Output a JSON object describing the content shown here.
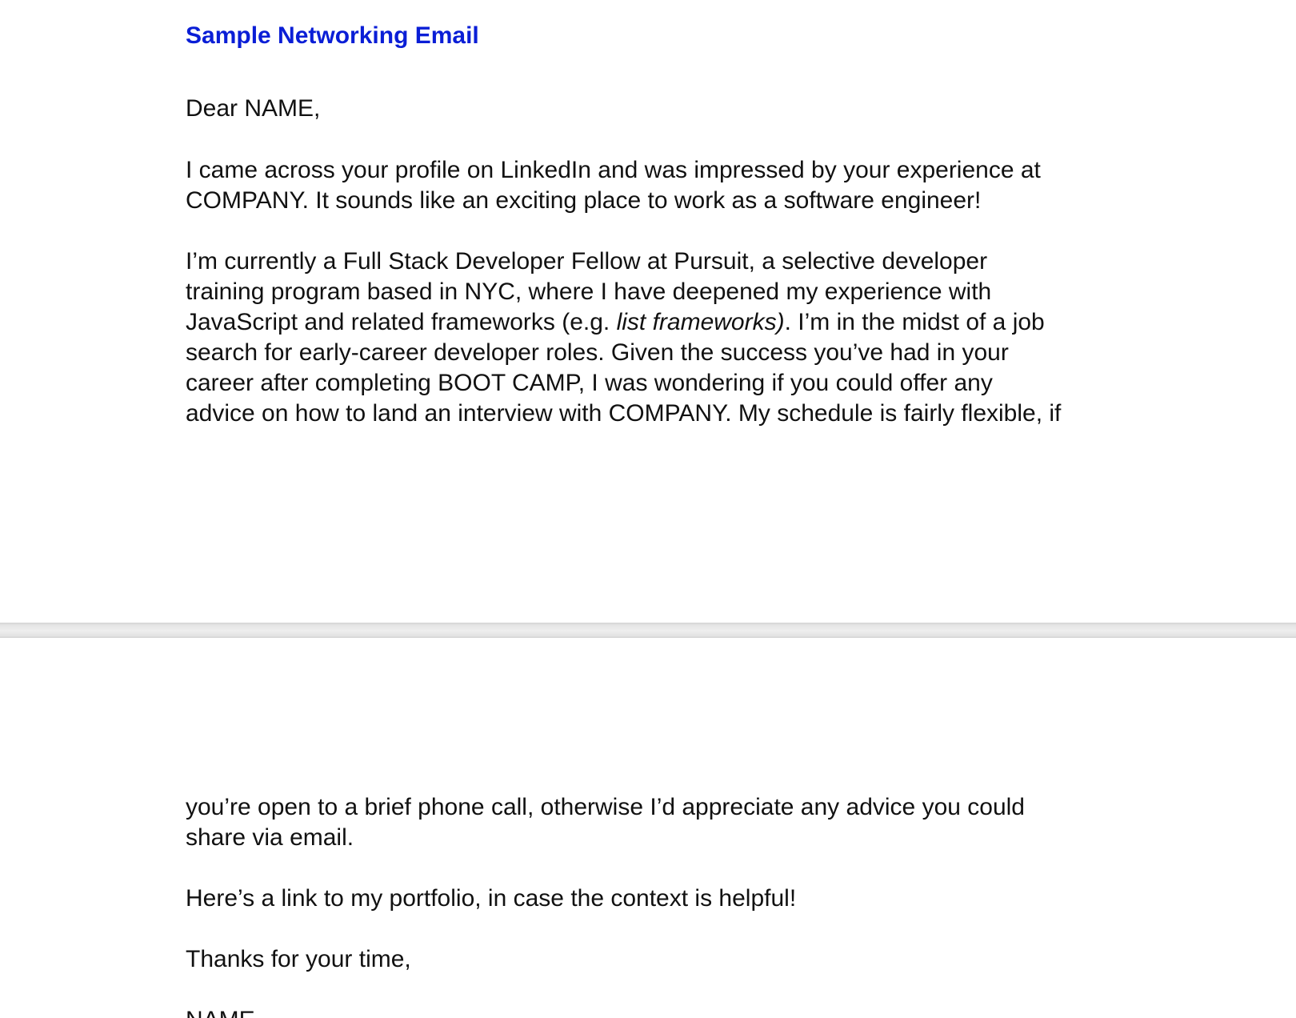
{
  "document": {
    "title": "Sample Networking Email",
    "greeting": "Dear NAME,",
    "paragraph1": [
      "I came across your profile on LinkedIn and was impressed by your experience at",
      "COMPANY. It sounds like an exciting place to work as a software engineer!"
    ],
    "paragraph2": {
      "line1": "I’m currently a Full Stack Developer Fellow at Pursuit, a selective developer",
      "line2": "training program based in NYC, where I have deepened my experience with",
      "line3_before": "JavaScript and related frameworks (e.g. ",
      "line3_italic": "list frameworks)",
      "line3_after": ". I’m in the midst of a job",
      "line4": "search for early-career developer roles. Given the success you’ve had in your",
      "line5": "career after completing BOOT CAMP, I was wondering if you could offer any",
      "line6": "advice on how to land an interview with COMPANY. My schedule is fairly flexible, if",
      "line7": "you’re open to a brief phone call, otherwise I’d appreciate any advice you could",
      "line8": "share via email."
    },
    "paragraph3": "Here’s a link to my portfolio, in case the context is helpful!",
    "closing": "Thanks for your time,",
    "signature": "NAME"
  }
}
